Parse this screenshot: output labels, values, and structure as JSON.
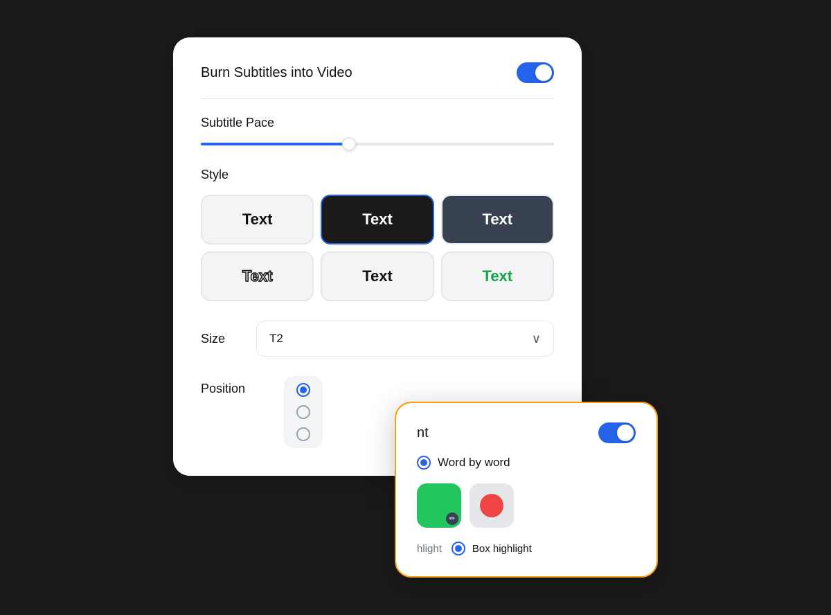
{
  "main_card": {
    "burn_subtitles_label": "Burn Subtitles into Video",
    "burn_subtitles_enabled": true,
    "subtitle_pace_label": "Subtitle Pace",
    "slider_value": 42,
    "style_label": "Style",
    "style_buttons": [
      {
        "id": "plain",
        "label": "Text",
        "variant": "plain",
        "selected": false
      },
      {
        "id": "dark",
        "label": "Text",
        "variant": "selected",
        "selected": true
      },
      {
        "id": "dark-bg",
        "label": "Text",
        "variant": "dark-bg",
        "selected": false
      },
      {
        "id": "outline",
        "label": "Text",
        "variant": "outline",
        "selected": false
      },
      {
        "id": "bold",
        "label": "Text",
        "variant": "bold",
        "selected": false
      },
      {
        "id": "green",
        "label": "Text",
        "variant": "green",
        "selected": false
      }
    ],
    "size_label": "Size",
    "size_value": "T2",
    "size_chevron": "∨",
    "position_label": "Position",
    "position_options": [
      {
        "id": "top",
        "checked": true
      },
      {
        "id": "middle",
        "checked": false
      },
      {
        "id": "bottom",
        "checked": false
      }
    ]
  },
  "secondary_card": {
    "toggle_label": "nt",
    "toggle_enabled": true,
    "word_by_word_label": "Word by word",
    "color_partial_label": "",
    "highlight_partial": "hlight",
    "highlight_box_label": "Box highlight",
    "colors": [
      {
        "id": "green-edit",
        "type": "green-edit"
      },
      {
        "id": "red",
        "type": "red"
      }
    ]
  }
}
